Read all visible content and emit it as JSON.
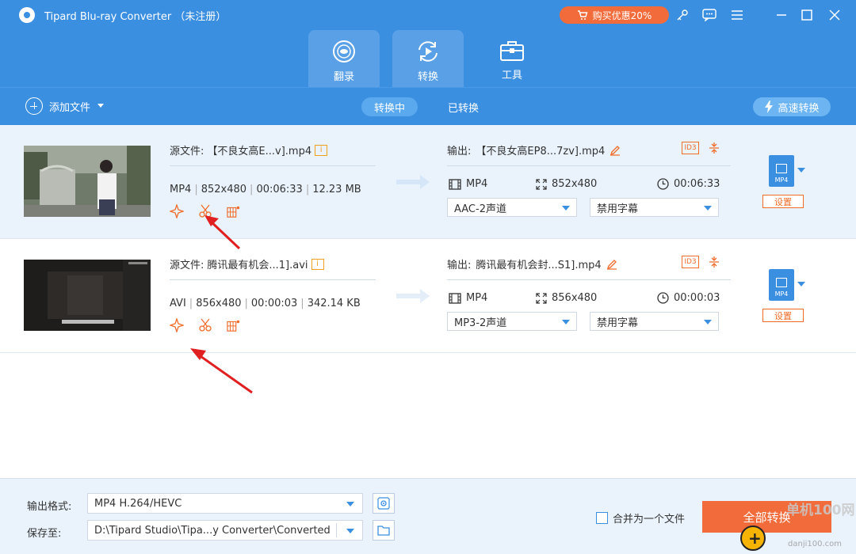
{
  "app": {
    "title": "Tipard Blu-ray Converter （未注册）",
    "buy_label": "购买优惠20%"
  },
  "nav": {
    "tabs": [
      {
        "label": "翻录",
        "icon": "disc-icon"
      },
      {
        "label": "转换",
        "icon": "convert-icon"
      },
      {
        "label": "工具",
        "icon": "toolbox-icon"
      }
    ]
  },
  "toolbar": {
    "add_file": "添加文件",
    "tab_converting": "转换中",
    "tab_converted": "已转换",
    "fast_convert": "高速转换"
  },
  "files": [
    {
      "source_label": "源文件:",
      "source_name": "【不良女高E...v].mp4",
      "format": "MP4",
      "resolution": "852x480",
      "duration": "00:06:33",
      "size": "12.23 MB",
      "output_label": "输出:",
      "output_name": "【不良女高EP8...7zv].mp4",
      "out_format": "MP4",
      "out_resolution": "852x480",
      "out_duration": "00:06:33",
      "audio": "AAC-2声道",
      "subtitle": "禁用字幕",
      "settings": "设置",
      "format_badge": "MP4"
    },
    {
      "source_label": "源文件:",
      "source_name": "腾讯最有机会...1].avi",
      "format": "AVI",
      "resolution": "856x480",
      "duration": "00:00:03",
      "size": "342.14 KB",
      "output_label": "输出:",
      "output_name": "腾讯最有机会封...S1].mp4",
      "out_format": "MP4",
      "out_resolution": "856x480",
      "out_duration": "00:00:03",
      "audio": "MP3-2声道",
      "subtitle": "禁用字幕",
      "settings": "设置",
      "format_badge": "MP4"
    }
  ],
  "bottom": {
    "format_label": "输出格式:",
    "format_value": "MP4 H.264/HEVC",
    "save_label": "保存至:",
    "save_value": "D:\\Tipard Studio\\Tipa...y Converter\\Converted",
    "merge_label": "合并为一个文件",
    "convert_all": "全部转换"
  },
  "watermark": {
    "text1": "单机100网",
    "text2": "danji100.com"
  },
  "colors": {
    "primary": "#3b8fe0",
    "accent": "#f26b3a",
    "row_highlight": "#eaf3fc"
  }
}
